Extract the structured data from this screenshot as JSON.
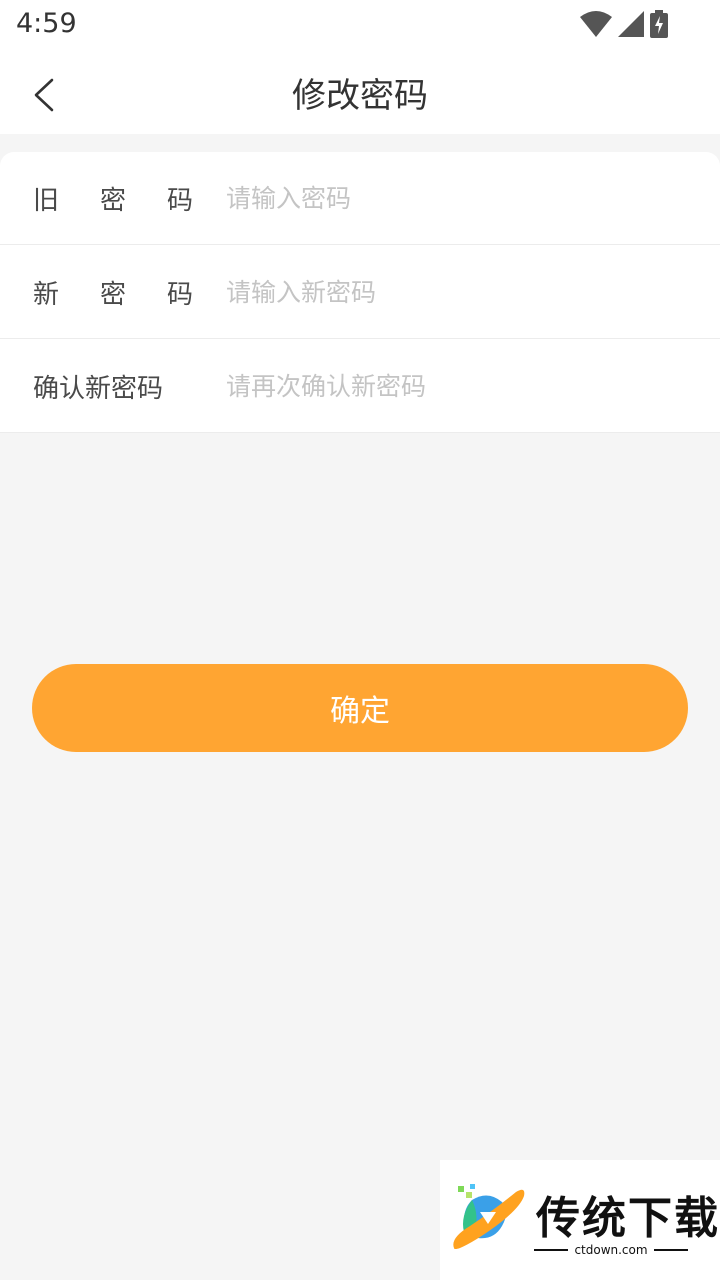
{
  "status_bar": {
    "time": "4:59",
    "icons": [
      "wifi-icon",
      "cellular-signal-icon",
      "battery-charging-icon"
    ]
  },
  "header": {
    "title": "修改密码",
    "back_icon": "chevron-left-icon"
  },
  "form": {
    "old_password": {
      "label_chars": [
        "旧",
        "密",
        "码"
      ],
      "placeholder": "请输入密码",
      "value": ""
    },
    "new_password": {
      "label_chars": [
        "新",
        "密",
        "码"
      ],
      "placeholder": "请输入新密码",
      "value": ""
    },
    "confirm_password": {
      "label": "确认新密码",
      "placeholder": "请再次确认新密码",
      "value": ""
    }
  },
  "confirm_button": {
    "label": "确定"
  },
  "watermark": {
    "name": "传统下载",
    "domain": "ctdown.com"
  },
  "colors": {
    "accent": "#ffa532",
    "background": "#f5f5f5",
    "surface": "#ffffff",
    "text_primary": "#333333",
    "placeholder": "#c4c4c4"
  }
}
